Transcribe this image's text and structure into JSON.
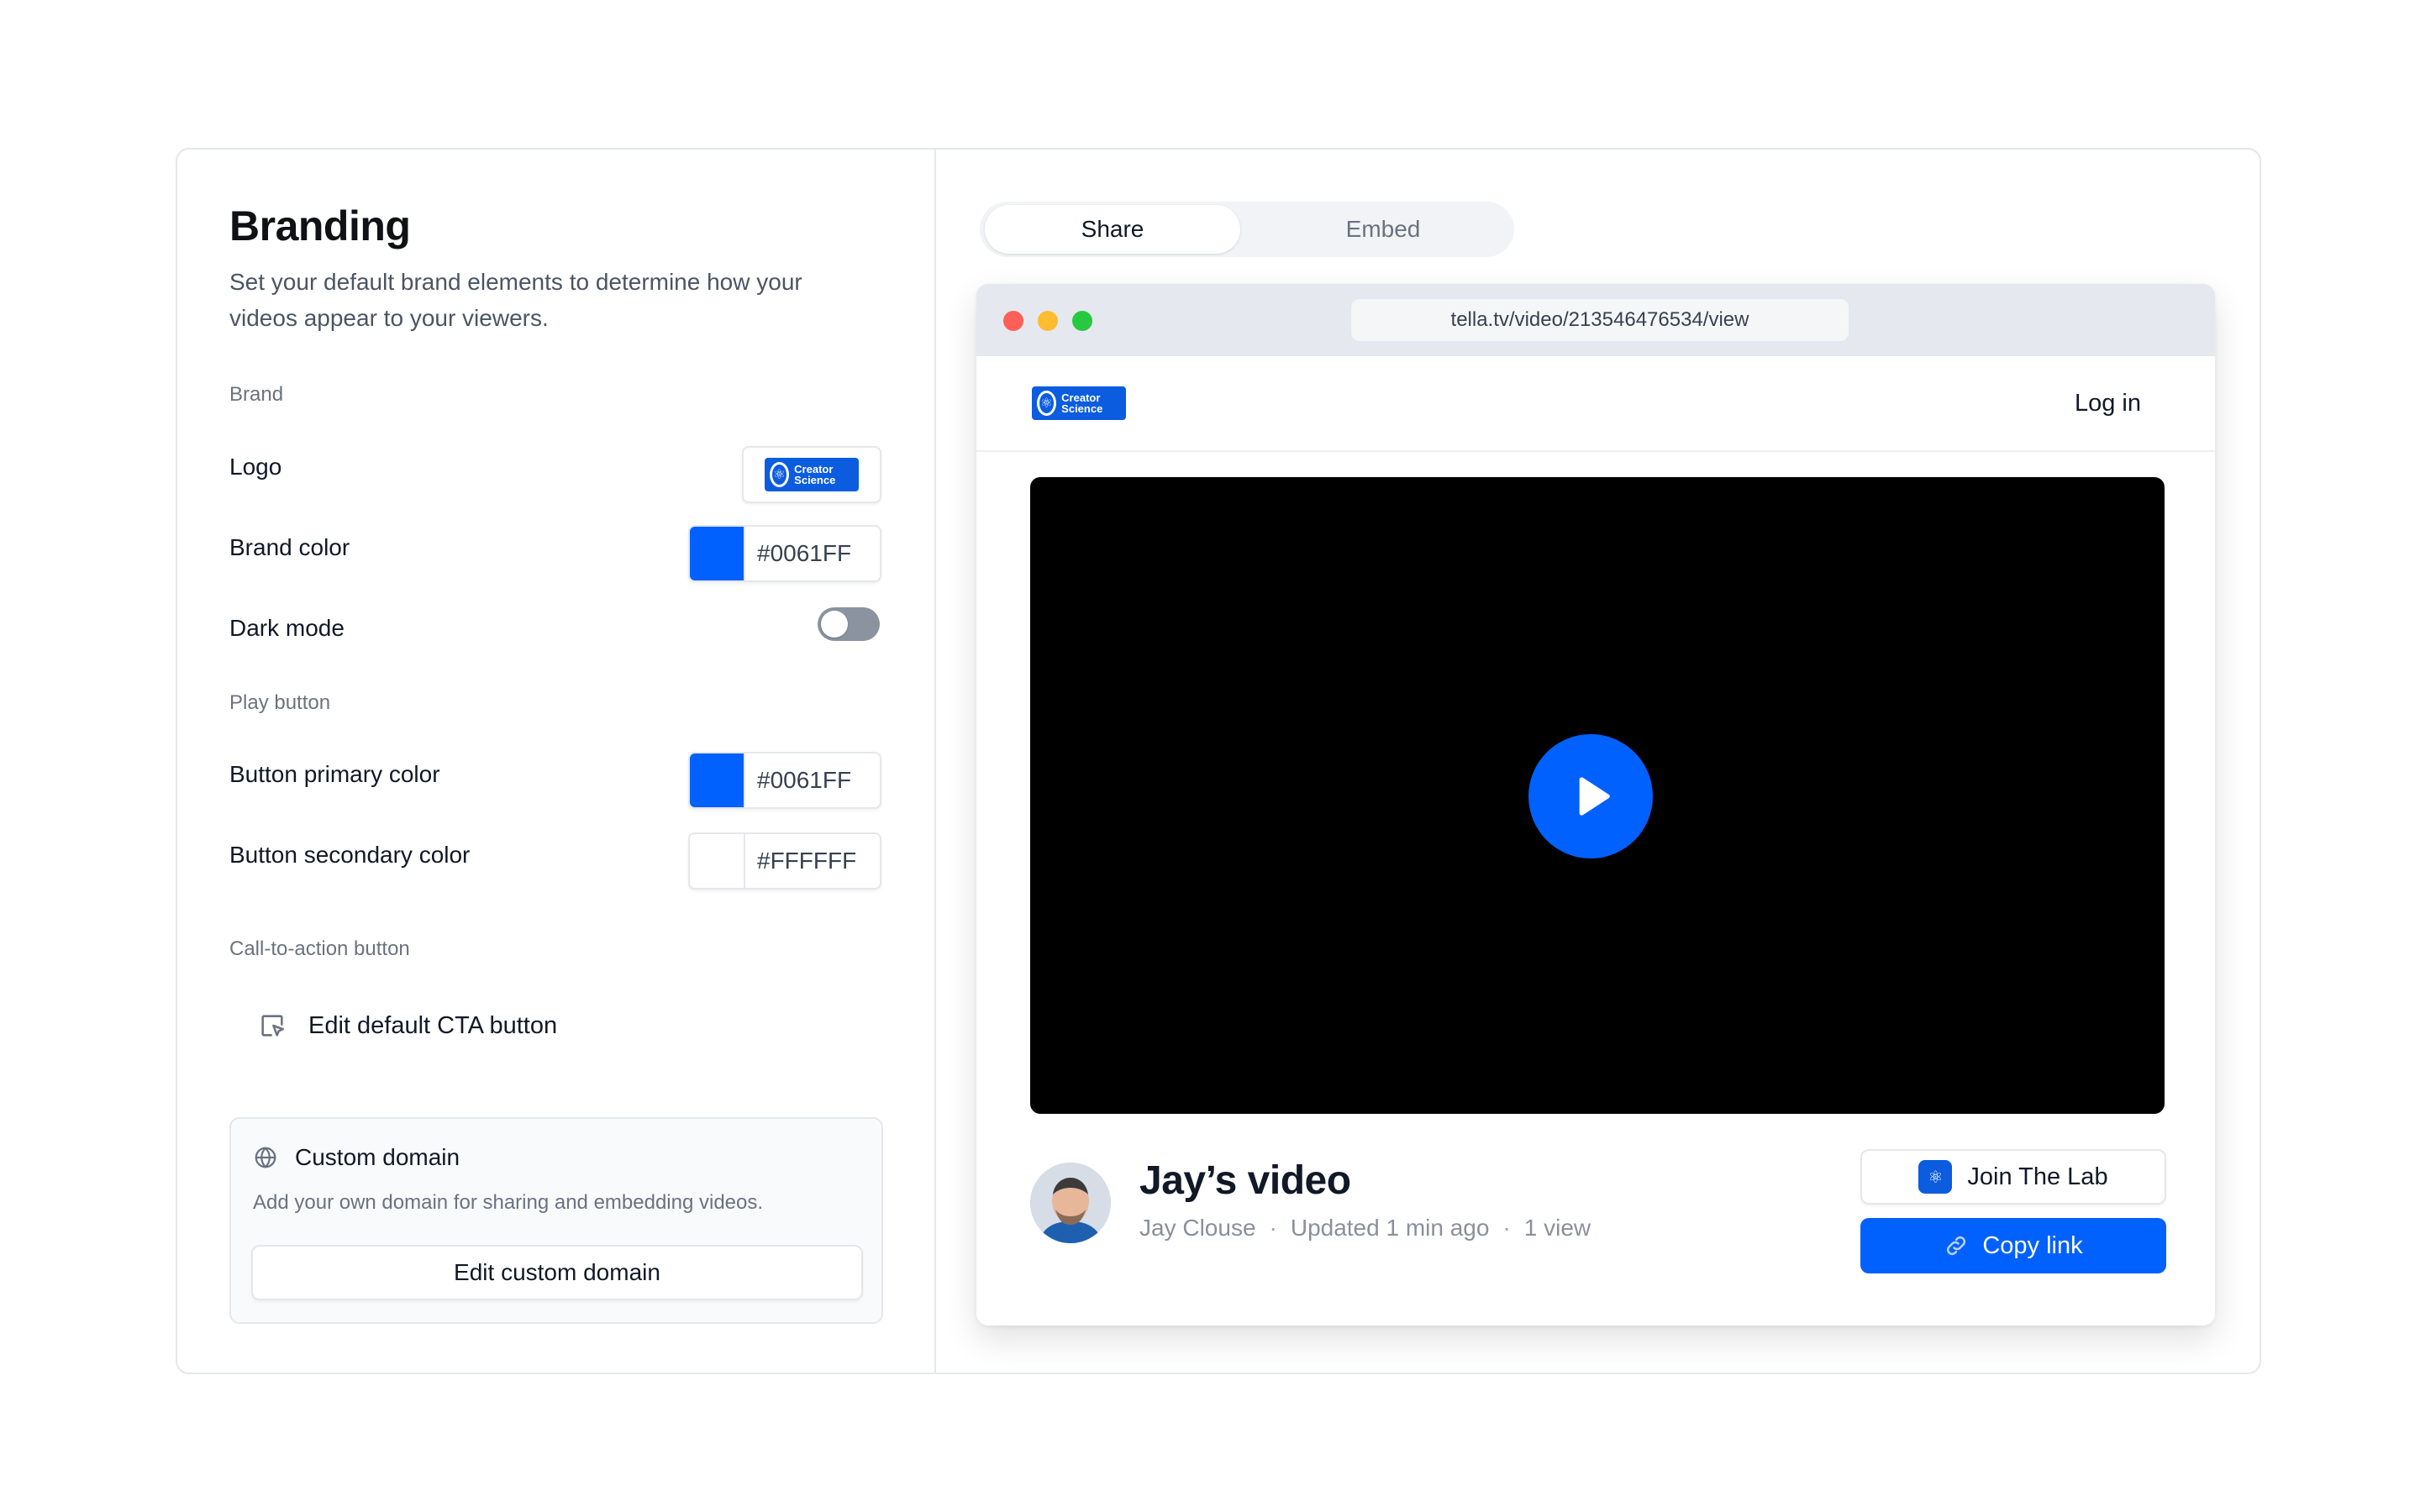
{
  "branding": {
    "title": "Branding",
    "subtitle": "Set your default brand elements to determine how your videos appear to your viewers.",
    "sections": {
      "brand": "Brand",
      "play_button": "Play button",
      "cta": "Call-to-action button"
    },
    "logo_label": "Logo",
    "logo_text": "Creator Science",
    "brand_color_label": "Brand color",
    "brand_color": "#0061FF",
    "dark_mode_label": "Dark mode",
    "dark_mode_enabled": false,
    "button_primary_label": "Button primary color",
    "button_primary_color": "#0061FF",
    "button_secondary_label": "Button secondary color",
    "button_secondary_color": "#FFFFFF",
    "cta_edit_label": "Edit default CTA button",
    "custom_domain": {
      "title": "Custom domain",
      "description": "Add your own domain for sharing and embedding videos.",
      "button": "Edit custom domain"
    }
  },
  "preview": {
    "tabs": [
      {
        "label": "Share",
        "active": true
      },
      {
        "label": "Embed",
        "active": false
      }
    ],
    "url": "tella.tv/video/213546476534/view",
    "login": "Log in",
    "video": {
      "title": "Jay’s video",
      "author": "Jay Clouse",
      "updated": "Updated 1 min ago",
      "views": "1 view",
      "separator": "·"
    },
    "join_button": "Join The Lab",
    "copy_button": "Copy link"
  },
  "colors": {
    "accent": "#0061ff",
    "traffic_red": "#ff5f57",
    "traffic_yellow": "#febc2e",
    "traffic_green": "#28c840"
  },
  "icons": [
    "cursor-click-icon",
    "globe-icon",
    "play-icon",
    "link-icon",
    "creator-science-logo"
  ]
}
